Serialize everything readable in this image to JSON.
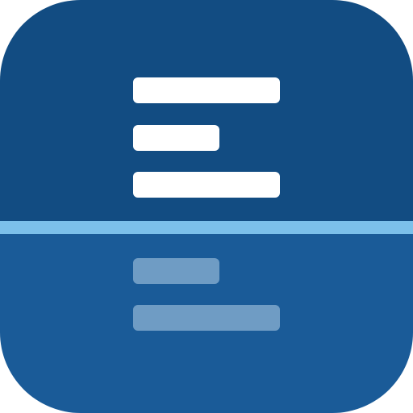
{
  "icon": {
    "name": "document-scanner-app-icon",
    "colors": {
      "top_background": "#124c82",
      "bottom_background": "#1a5b98",
      "scan_line": "#7cc0ea",
      "document_lines": "#ffffff",
      "reflection_lines": "#6f9cc4"
    },
    "document_lines": 3,
    "reflected_lines": 2
  }
}
